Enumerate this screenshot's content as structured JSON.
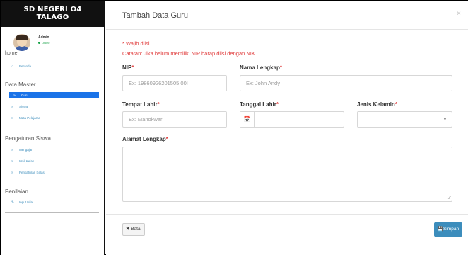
{
  "sidebar": {
    "brand_line1": "SD NEGERI O4",
    "brand_line2": "TALAGO",
    "user": {
      "name": "Admin",
      "status": "Online"
    },
    "home_header": "home",
    "home_item": "Beranda",
    "sections": [
      {
        "title": "Data Master",
        "items": [
          "Guru",
          "Siswa",
          "Mata Pelajaran"
        ]
      },
      {
        "title": "Pengaturan Siswa",
        "items": [
          "Mengajar",
          "Wali Kelas",
          "Pengaturan Kelas"
        ]
      },
      {
        "title": "Penilaian",
        "items": [
          "Input Nilai"
        ]
      }
    ],
    "active_item": "Guru"
  },
  "modal": {
    "title": "Tambah Data Guru",
    "close": "×",
    "required_note": "* Wajib diisi",
    "catatan": "Catatan: Jika belum memiliki NIP harap diisi dengan NIK",
    "fields": {
      "nip": {
        "label": "NIP",
        "placeholder": "Ex: 19860926201505I00I"
      },
      "nama": {
        "label": "Nama Lengkap",
        "placeholder": "Ex: John Andy"
      },
      "tempat": {
        "label": "Tempat Lahir",
        "placeholder": "Ex: Manokwari"
      },
      "tanggal": {
        "label": "Tanggal Lahir",
        "value": ""
      },
      "jk": {
        "label": "Jenis Kelamin",
        "value": ""
      },
      "alamat": {
        "label": "Alamat Lengkap",
        "value": ""
      }
    },
    "star": "*",
    "buttons": {
      "batal": "Batal",
      "simpan": "Simpan"
    }
  },
  "icons": {
    "home": "home-icon",
    "calendar": "calendar-icon",
    "close": "close-icon",
    "save": "save-icon"
  },
  "colors": {
    "sidebar_active": "#1a73e8",
    "link": "#3c8dbc",
    "required": "#e03a3a",
    "primary_button": "#3c8dbc"
  }
}
